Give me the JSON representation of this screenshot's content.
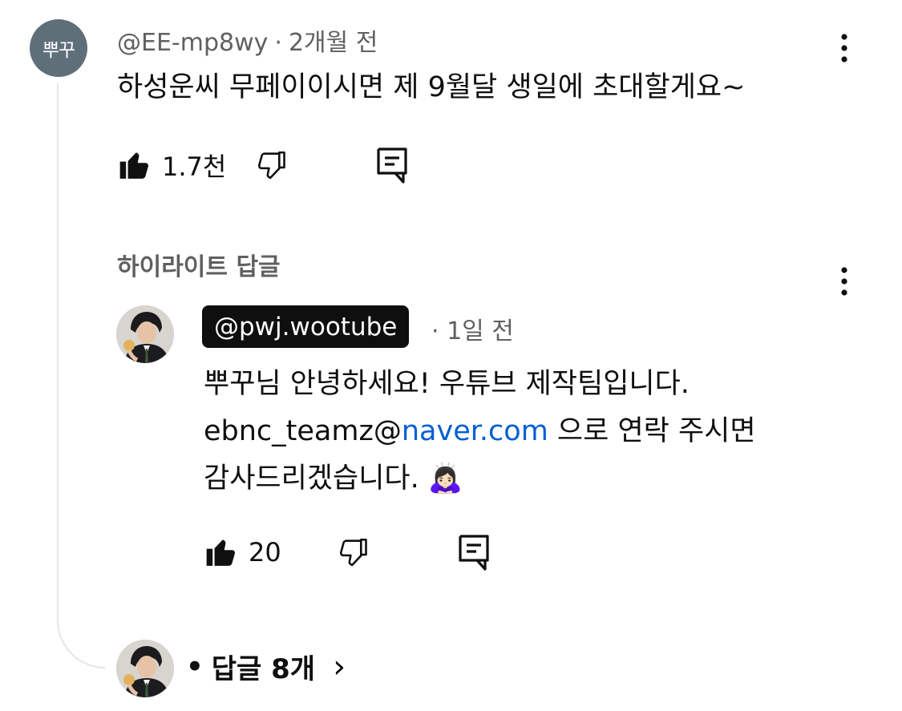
{
  "comment": {
    "avatar_text": "뿌꾸",
    "author": "@EE-mp8wy",
    "time": "2개월 전",
    "text": "하성운씨 무페이이시면 제 9월달 생일에 초대할게요~",
    "like_count": "1.7천"
  },
  "highlight": {
    "label": "하이라이트 답글"
  },
  "reply": {
    "author": "@pwj.wootube",
    "time": "1일 전",
    "line1": "뿌꾸님 안녕하세요! 우튜브 제작팀입니다.",
    "email_user": "ebnc_teamz@",
    "email_domain": "naver.com",
    "line2_suffix": " 으로 연락 주시면",
    "line3": "감사드리겠습니다.",
    "emoji": "🙇🏻‍♀️",
    "like_count": "20"
  },
  "replies_footer": {
    "separator": "•",
    "label": "답글 8개",
    "chevron": "›"
  },
  "icons": {
    "like": "thumbs-up-icon",
    "dislike": "thumbs-down-icon",
    "reply": "comment-reply-icon",
    "more": "more-vertical-icon"
  }
}
